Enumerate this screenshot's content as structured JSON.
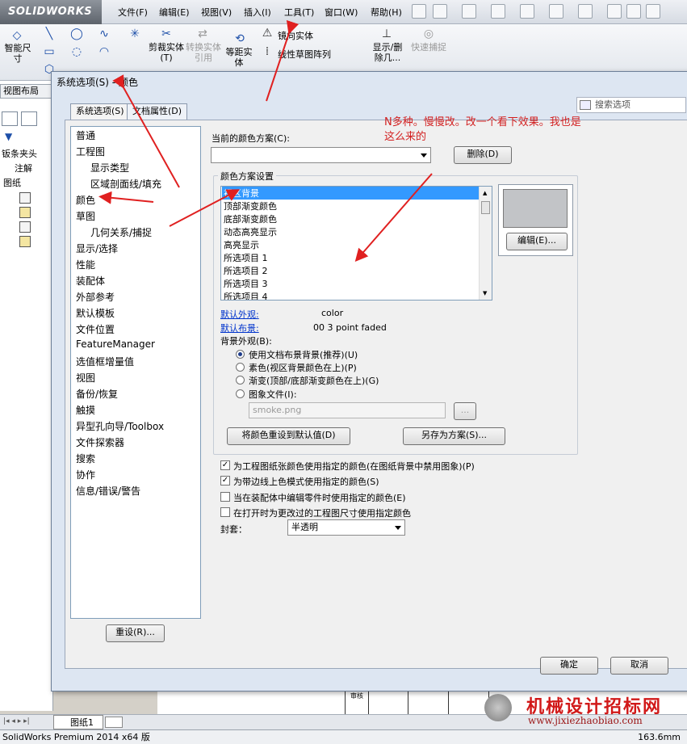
{
  "app": {
    "logo": "SOLIDWORKS",
    "menus": [
      "文件(F)",
      "编辑(E)",
      "视图(V)",
      "插入(I)",
      "工具(T)",
      "窗口(W)",
      "帮助(H)"
    ],
    "status_left": "SolidWorks Premium 2014 x64 版",
    "status_right": "163.6mm",
    "sheet_tab": "图纸1",
    "view_layout_tab": "视图布局"
  },
  "toolbar": {
    "smart_dim": "智能尺寸",
    "trim": "剪裁实体(T)",
    "convert": "转换实体引用",
    "offset": "等距实体",
    "mirror": "镜向实体",
    "linear_pattern": "线性草图阵列",
    "show_delete": "显示/删除几...",
    "quick_snap": "快速捕捉"
  },
  "tree": {
    "items": [
      "钣条夹头",
      "注解",
      "图纸",
      "",
      "",
      "",
      ""
    ]
  },
  "dialog": {
    "title": "系统选项(S) - 颜色",
    "tabs": [
      "系统选项(S)",
      "文档属性(D)"
    ],
    "search_placeholder": "搜索选项",
    "categories": [
      {
        "label": "普通",
        "sub": false
      },
      {
        "label": "工程图",
        "sub": false
      },
      {
        "label": "显示类型",
        "sub": true
      },
      {
        "label": "区域剖面线/填充",
        "sub": true
      },
      {
        "label": "颜色",
        "sub": false
      },
      {
        "label": "草图",
        "sub": false
      },
      {
        "label": "几何关系/捕捉",
        "sub": true
      },
      {
        "label": "显示/选择",
        "sub": false
      },
      {
        "label": "性能",
        "sub": false
      },
      {
        "label": "装配体",
        "sub": false
      },
      {
        "label": "外部参考",
        "sub": false
      },
      {
        "label": "默认模板",
        "sub": false
      },
      {
        "label": "文件位置",
        "sub": false
      },
      {
        "label": "FeatureManager",
        "sub": false
      },
      {
        "label": "选值框增量值",
        "sub": false
      },
      {
        "label": "视图",
        "sub": false
      },
      {
        "label": "备份/恢复",
        "sub": false
      },
      {
        "label": "触摸",
        "sub": false
      },
      {
        "label": "异型孔向导/Toolbox",
        "sub": false
      },
      {
        "label": "文件探索器",
        "sub": false
      },
      {
        "label": "搜索",
        "sub": false
      },
      {
        "label": "协作",
        "sub": false
      },
      {
        "label": "信息/错误/警告",
        "sub": false
      }
    ],
    "current_scheme_label": "当前的颜色方案(C):",
    "current_scheme_value": "",
    "delete_button": "删除(D)",
    "scheme_group_title": "颜色方案设置",
    "color_items": [
      "视区背景",
      "顶部渐变颜色",
      "底部渐变颜色",
      "动态高亮显示",
      "高亮显示",
      "所选项目 1",
      "所选项目 2",
      "所选项目 3",
      "所选项目 4"
    ],
    "selected_index": 0,
    "edit_button": "编辑(E)...",
    "default_appearance_label": "默认外观:",
    "default_appearance_value": "color",
    "default_scene_label": "默认布景:",
    "default_scene_value": "00 3 point faded",
    "background_label": "背景外观(B):",
    "background_options": [
      "使用文档布景背景(推荐)(U)",
      "素色(视区背景颜色在上)(P)",
      "渐变(顶部/底部渐变颜色在上)(G)",
      "图象文件(I):"
    ],
    "background_selected": 0,
    "image_file": "smoke.png",
    "browse_button": "...",
    "reset_colors_button": "将颜色重设到默认值(D)",
    "save_scheme_button": "另存为方案(S)...",
    "checkboxes": [
      {
        "label": "为工程图纸张颜色使用指定的颜色(在图纸背景中禁用图象)(P)",
        "checked": true
      },
      {
        "label": "为带边线上色模式使用指定的颜色(S)",
        "checked": true
      },
      {
        "label": "当在装配体中编辑零件时使用指定的颜色(E)",
        "checked": false
      },
      {
        "label": "在打开时为更改过的工程图尺寸使用指定颜色",
        "checked": false
      }
    ],
    "envelope_label": "封套：",
    "envelope_value": "半透明",
    "reset_button": "重设(R)...",
    "ok_button": "确定",
    "cancel_button": "取消"
  },
  "annotation": {
    "text_line1": "N多种。慢慢改。改一个看下效果。我也是",
    "text_line2": "这么来的",
    "color": "#d21f1f"
  },
  "drawing": {
    "cell": "审核"
  },
  "watermark": {
    "line1": "机械设计招标网",
    "line2": "www.jixiezhaobiao.com"
  }
}
